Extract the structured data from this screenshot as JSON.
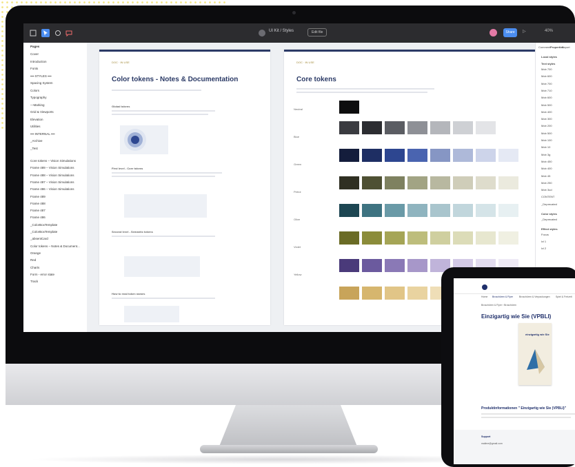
{
  "figma": {
    "file_title": "UI Kit / Styles",
    "title_action": "Edit file",
    "share_label": "Share",
    "zoom": "40%",
    "pages_header": "Pages",
    "pages": [
      "Cover",
      "Introduction",
      "Fonts",
      "━━ STYLES ━━",
      "Spacing System",
      "Colors",
      "Typography",
      "—Marking",
      "Grid & Viewports",
      "Elevation",
      "Utilities",
      "━━ INTERNAL ━━",
      "_Archive",
      "_Test"
    ],
    "layers": [
      "Core tokens – Vision Simulations",
      "Frame 489 – Vision Simulations",
      "Frame 488 – Vision Simulations",
      "Frame 487 – Vision Simulations",
      "Frame 486 – Vision Simulations",
      "Frame 489",
      "Frame 488",
      "Frame 487",
      "Frame 486",
      "_ColorBoxTemplate",
      "_ColorBoxTemplate",
      "_absentCard",
      "Color tokens – Notes & Document...",
      "Orange",
      "Red",
      "Charts",
      "Form - error state",
      "Track"
    ]
  },
  "frame1": {
    "label": "Color tokens – Notes & Documentation",
    "tag": "DOC · IN USE",
    "title": "Color tokens - Notes & Documentation",
    "sections": [
      "Global tokens",
      "First level - Core tokens",
      "Second level - Semantic tokens",
      "How to read token names"
    ]
  },
  "frame2": {
    "label": "Core tokens",
    "tag": "DOC · IN USE",
    "title": "Core tokens",
    "rows": [
      {
        "label": "Neutral",
        "colors": [
          "#0d0d0e",
          "#3a3b40",
          "#2c2d31",
          "#5b5d63",
          "#8e9096",
          "#b4b6bb",
          "#ced0d4",
          "#e3e4e7"
        ]
      },
      {
        "label": "Blue",
        "colors": [
          "#141d3c",
          "#1e2e63",
          "#2d4690",
          "#4a64b0",
          "#8696c4",
          "#aeb9d9",
          "#cdd4ea",
          "#e5e9f4"
        ]
      },
      {
        "label": "Green",
        "colors": [
          "#2f2f22",
          "#4e5033",
          "#7e8160",
          "#a2a484",
          "#b8b8a0",
          "#cfcdb9",
          "#dedccc",
          "#ebeade"
        ]
      },
      {
        "label": "Petrol",
        "colors": [
          "#1d4652",
          "#3e7381",
          "#6a9aa7",
          "#8fb4bf",
          "#a9c5cd",
          "#c1d6dc",
          "#d5e4e8",
          "#e7f0f2"
        ]
      },
      {
        "label": "Olive",
        "colors": [
          "#6a6b25",
          "#8b8c3a",
          "#a5a556",
          "#bdbd7c",
          "#cfcf9f",
          "#dcdcb8",
          "#e7e7cf",
          "#f0f0e2"
        ]
      },
      {
        "label": "Violet",
        "colors": [
          "#4a3a7a",
          "#6b5a9e",
          "#8a79b6",
          "#a797c9",
          "#c0b4da",
          "#d3cae6",
          "#e2dcef",
          "#eeeaf6"
        ]
      },
      {
        "label": "Yellow",
        "colors": [
          "#c8a45a",
          "#d6b66e",
          "#e1c587",
          "#e9d3a0",
          "#efdeb7",
          "#f3e7c9",
          "#f6eeda",
          "#f9f4e8"
        ]
      }
    ]
  },
  "right_panel": {
    "tabs": [
      "Comment",
      "Properties",
      "Export"
    ],
    "local_styles": "Local styles",
    "text_styles_header": "Text styles",
    "text_styles": [
      "Mob 700",
      "Mob 600",
      "Mob 700",
      "Mob 710",
      "Mob 600",
      "Mob 500",
      "Mob 400",
      "Mob 300",
      "Mob 200",
      "Mob 500",
      "Mob 100",
      "Mob 10",
      "Mob 3g",
      "Mob 450",
      "Mob 400",
      "Mob 45",
      "Mob 250",
      "Mob 3ud",
      "CONTENT",
      "_Deprecated"
    ],
    "color_styles_header": "Color styles",
    "color_styles": [
      "_Deprecated"
    ],
    "effect_styles_header": "Effect styles",
    "effect_styles": [
      "Focus",
      "lvl 1",
      "lvl 2"
    ]
  },
  "tablet": {
    "nav": [
      "Home",
      "Broschüren & Flyer",
      "Broschüren & Verpackungen",
      "Spiel & Freizeit"
    ],
    "breadcrumb": "Broschüren & Flyer › Broschüren",
    "title": "Einzigartig wie Sie (VPBLI)",
    "cover_title": "einzigartig wie Sie",
    "section": "Produktinformationen \" Einzigartig wie Sie (VPBLI)\"",
    "footer_label": "Support",
    "footer_email": "mailme@gmail.com"
  }
}
